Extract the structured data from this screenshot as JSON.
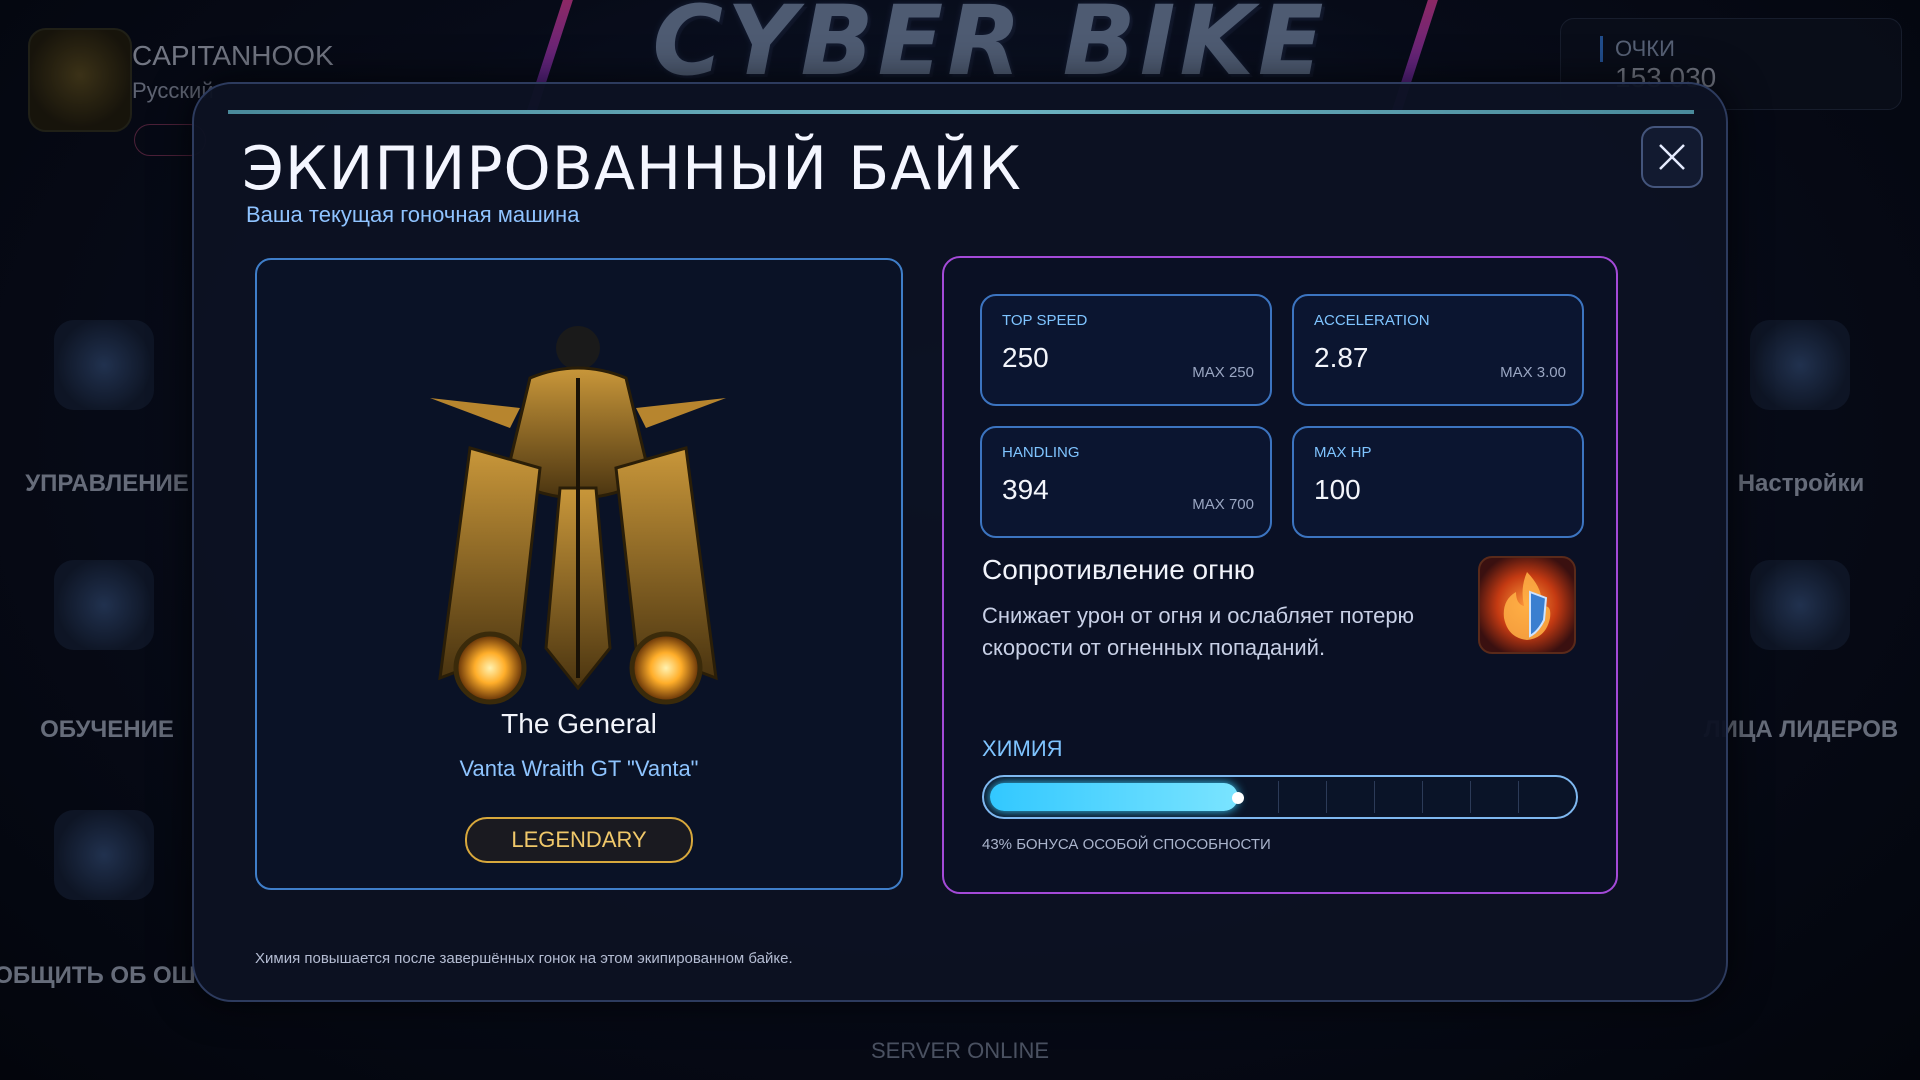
{
  "game": {
    "logo_text": "CYBER BIKE"
  },
  "profile": {
    "name": "CAPITANHOOK",
    "language": "Русский"
  },
  "score": {
    "label": "ОЧКИ",
    "value": "153 030"
  },
  "side_menu": {
    "left": [
      {
        "label": "УПРАВЛЕНИЕ",
        "icon": "keyboard-icon"
      },
      {
        "label": "ОБУЧЕНИЕ",
        "icon": "book-icon"
      },
      {
        "label": "ОБЩИТЬ ОБ ОШ",
        "icon": "bug-report-icon"
      }
    ],
    "right": [
      {
        "label": "Настройки",
        "icon": "gear-icon"
      },
      {
        "label": "ЛИЦА ЛИДЕРОВ",
        "icon": "trophy-icon"
      }
    ]
  },
  "server_status": "SERVER ONLINE",
  "modal": {
    "title": "ЭКИПИРОВАННЫЙ БАЙК",
    "subtitle": "Ваша текущая гоночная машина",
    "close_icon": "close-icon",
    "bike": {
      "name": "The General",
      "model": "Vanta Wraith GT \"Vanta\"",
      "rarity": "LEGENDARY"
    },
    "stats": [
      {
        "label": "TOP SPEED",
        "value": "250",
        "max": "MAX 250"
      },
      {
        "label": "ACCELERATION",
        "value": "2.87",
        "max": "MAX 3.00"
      },
      {
        "label": "HANDLING",
        "value": "394",
        "max": "MAX 700"
      },
      {
        "label": "MAX HP",
        "value": "100",
        "max": ""
      }
    ],
    "ability": {
      "title": "Сопротивление огню",
      "description": "Снижает урон от огня и ослабляет потерю скорости от огненных попаданий.",
      "icon": "fire-shield-icon"
    },
    "chemistry": {
      "label": "ХИМИЯ",
      "progress": 0.43,
      "caption": "43% БОНУСА ОСОБОЙ СПОСОБНОСТИ"
    },
    "footer_note": "Химия повышается после завершённых гонок на этом экипированном байке."
  },
  "colors": {
    "accent_blue": "#3c74c0",
    "accent_purple": "#a44ad8",
    "legendary_gold": "#d8a83c",
    "chem_fill": "#32c8ff"
  }
}
